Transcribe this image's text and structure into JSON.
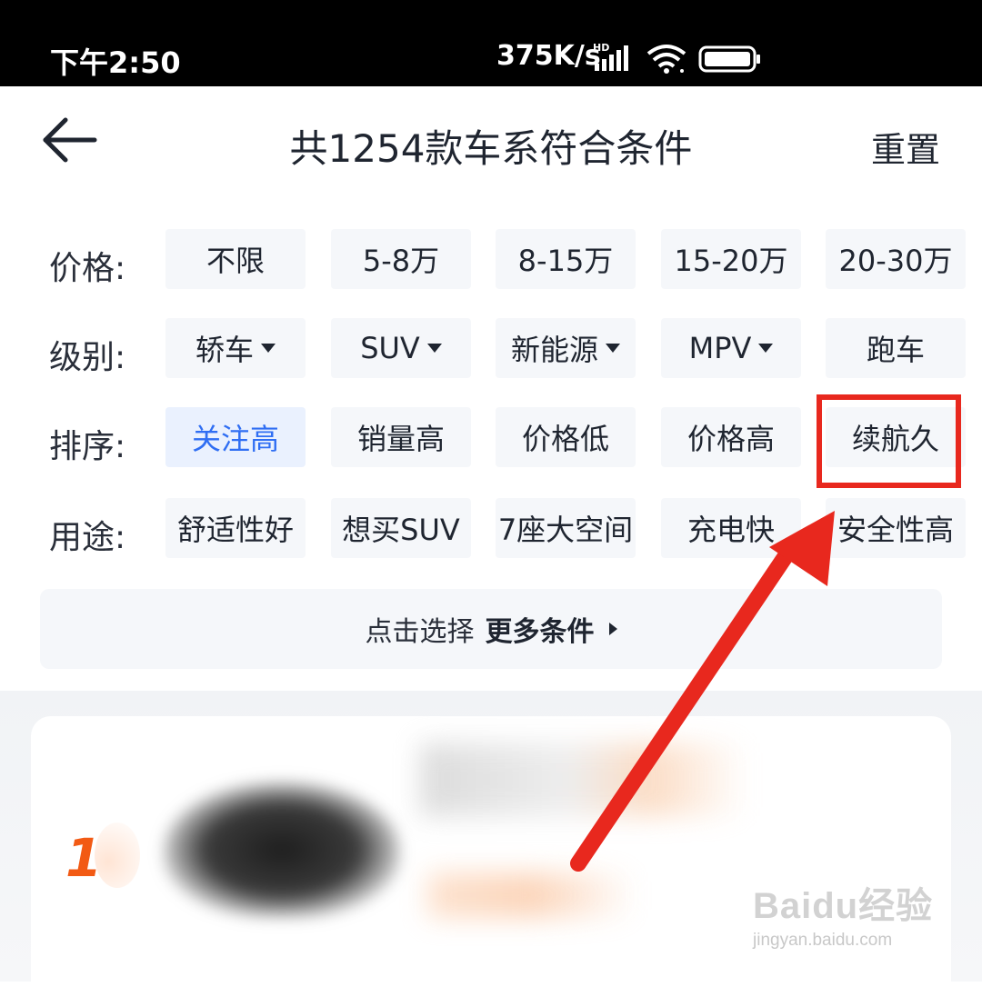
{
  "status_bar": {
    "time": "下午2:50",
    "net_speed": "375K/s",
    "signal_icon": "signal-hd-icon",
    "wifi_icon": "wifi-icon",
    "battery_icon": "battery-icon"
  },
  "header": {
    "back_icon": "arrow-left-icon",
    "title": "共1254款车系符合条件",
    "reset_label": "重置"
  },
  "filters": [
    {
      "label": "价格:",
      "options": [
        {
          "text": "不限"
        },
        {
          "text": "5-8万"
        },
        {
          "text": "8-15万"
        },
        {
          "text": "15-20万"
        },
        {
          "text": "20-30万"
        }
      ]
    },
    {
      "label": "级别:",
      "options": [
        {
          "text": "轿车",
          "dropdown": true
        },
        {
          "text": "SUV",
          "dropdown": true
        },
        {
          "text": "新能源",
          "dropdown": true
        },
        {
          "text": "MPV",
          "dropdown": true
        },
        {
          "text": "跑车"
        }
      ]
    },
    {
      "label": "排序:",
      "options": [
        {
          "text": "关注高",
          "selected": true
        },
        {
          "text": "销量高"
        },
        {
          "text": "价格低"
        },
        {
          "text": "价格高"
        },
        {
          "text": "续航久",
          "highlighted": true
        }
      ]
    },
    {
      "label": "用途:",
      "options": [
        {
          "text": "舒适性好"
        },
        {
          "text": "想买SUV"
        },
        {
          "text": "7座大空间"
        },
        {
          "text": "充电快"
        },
        {
          "text": "安全性高"
        }
      ]
    }
  ],
  "more": {
    "prefix": "点击选择",
    "bold": "更多条件",
    "icon": "triangle-right-icon"
  },
  "result_list": {
    "first_rank": "1"
  },
  "annotation": {
    "color": "#e8281e"
  },
  "watermark": {
    "main": "Baidu经验",
    "sub": "jingyan.baidu.com"
  },
  "colors": {
    "accent_blue": "#2f6ef3",
    "chip_bg": "#f5f7fa",
    "rank_orange": "#f25a14"
  }
}
